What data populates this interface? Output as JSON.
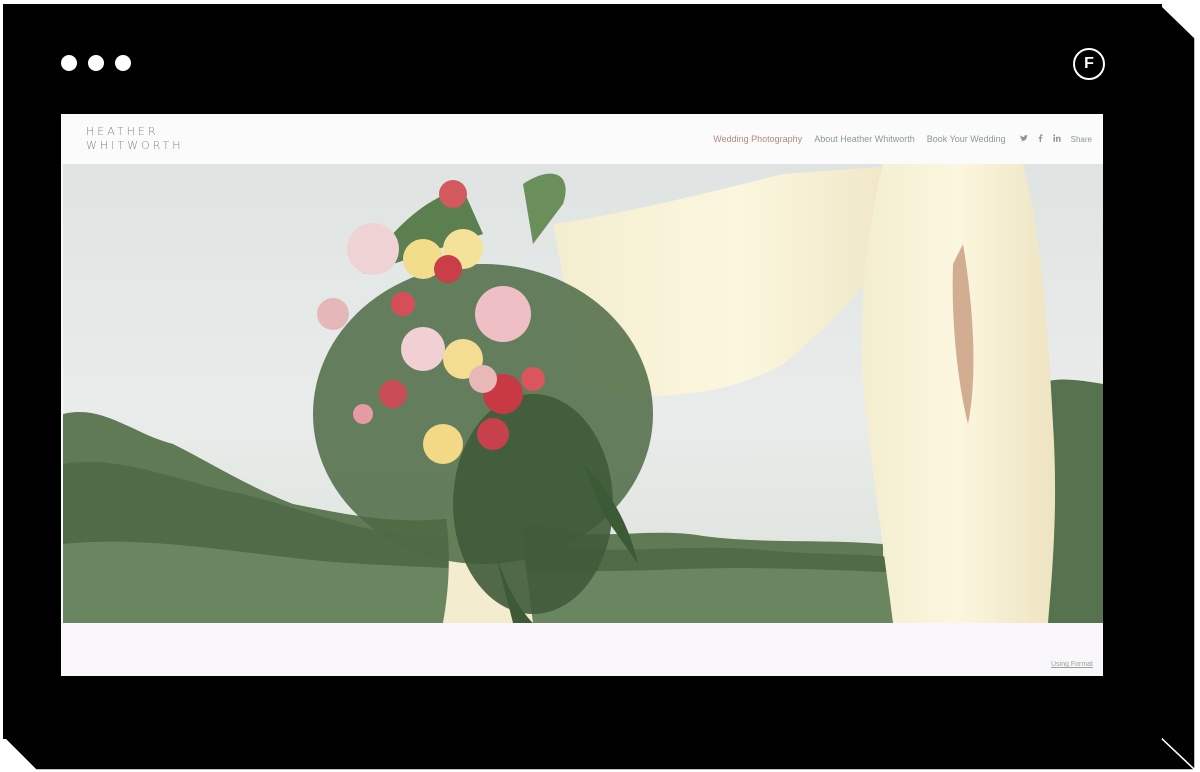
{
  "window": {
    "controls": [
      "close",
      "minimize",
      "maximize"
    ],
    "brand_icon": "format-f-icon",
    "brand_letter": "F"
  },
  "site": {
    "logo_line1": "HEATHER",
    "logo_line2": "WHITWORTH",
    "nav": [
      {
        "label": "Wedding Photography",
        "active": true
      },
      {
        "label": "About Heather Whitworth",
        "active": false
      },
      {
        "label": "Book Your Wedding",
        "active": false
      }
    ],
    "social": {
      "twitter": "twitter-icon",
      "facebook": "facebook-icon",
      "linkedin": "linkedin-icon",
      "share_label": "Share"
    },
    "footer_link": "Using Format"
  },
  "colors": {
    "frame": "#000000",
    "nav_active": "#b38a7c",
    "nav_text": "#8a9a92",
    "logo": "#7a8a80"
  }
}
